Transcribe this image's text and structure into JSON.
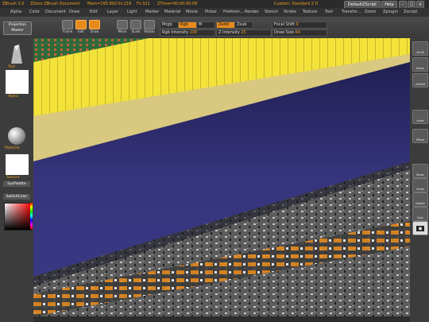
{
  "title_bar": {
    "app": "ZBrush 2.0",
    "doc": "ZDocs ZBrush Document",
    "mem": "Mem=295.892",
    "vs": "Vs:216",
    "fs": "Fs:321",
    "ztime": "ZTime=00:00:00.08",
    "custom": "Custom: Standard 2 D",
    "script_btn": "DefaultZScript",
    "help_btn": "Help"
  },
  "menu": [
    "Alpha",
    "Color",
    "Document",
    "Draw",
    "Edit",
    "Layer",
    "Light",
    "Marker",
    "Material",
    "Movie",
    "Picker",
    "Preferen...",
    "Render",
    "Stencil",
    "Stroke",
    "Texture",
    "Tool",
    "Transfor...",
    "Zoom",
    "Zplugin",
    "Zscript"
  ],
  "shelf": {
    "projection_master": "Projection Master",
    "buttons": [
      "Frame",
      "Edit",
      "Draw",
      "Move",
      "Scale",
      "Rotate"
    ],
    "mrgb": "Mrgb",
    "rgb": "Rgb",
    "m": "M",
    "rgb_intensity_label": "Rgb Intensity",
    "rgb_intensity_value": "100",
    "zadd": "Zadd",
    "zsub": "Zsub",
    "z_intensity_label": "Z Intensity",
    "z_intensity_value": "25",
    "focal_shift_label": "Focal Shift",
    "focal_shift_value": "0",
    "draw_size_label": "Draw Size",
    "draw_size_value": "64"
  },
  "left": {
    "tool_label": "Tool",
    "alpha_label": "Alpha",
    "material_label": "Material",
    "texture_label": "Texture",
    "syspalette": "SysPalette",
    "switchcolor": "SwitchColor"
  },
  "right": [
    "Scroll",
    "Zoom",
    "AAHalf",
    "Local",
    "XPose",
    "Move",
    "Scale",
    "Rotate",
    "Spix",
    "Snapshot"
  ],
  "colors": {
    "accent": "#e88a1a",
    "canvas": "#2a2860",
    "yellow": "#f2e23a"
  }
}
